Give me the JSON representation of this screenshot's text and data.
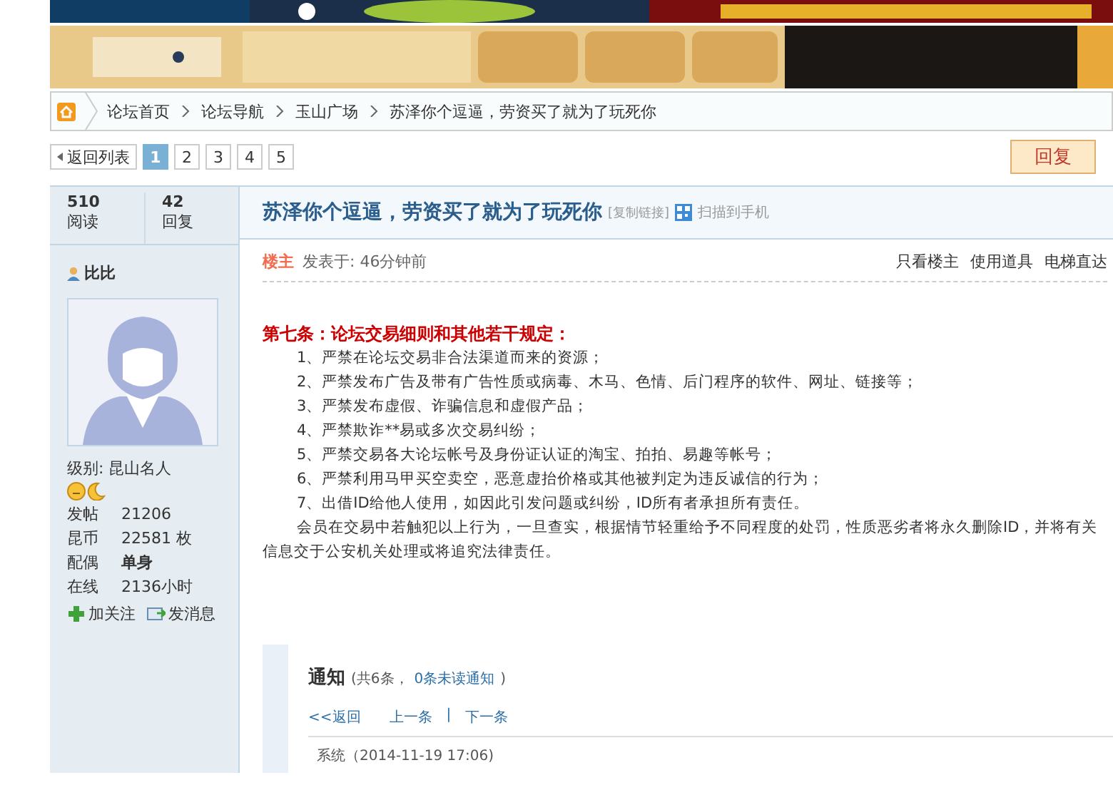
{
  "banners": [
    {
      "kind": "picture"
    },
    {
      "kind": "picture"
    }
  ],
  "breadcrumb": [
    "论坛首页",
    "论坛导航",
    "玉山广场",
    "苏泽你个逗逼，劳资买了就为了玩死你"
  ],
  "pagination": {
    "back": "返回列表",
    "pages": [
      {
        "label": "1",
        "selected": true
      },
      {
        "label": "2",
        "selected": false
      },
      {
        "label": "3",
        "selected": false
      },
      {
        "label": "4",
        "selected": false
      },
      {
        "label": "5",
        "selected": false
      }
    ],
    "reply": "回复"
  },
  "stats": [
    {
      "value": "510",
      "label": "阅读"
    },
    {
      "value": "42",
      "label": "回复"
    }
  ],
  "thread": {
    "title": "苏泽你个逗逼，劳资买了就为了玩死你",
    "copy_link": "[复制链接]",
    "qr": "扫描到手机"
  },
  "author": {
    "name": "比比",
    "level": "级别: 昆山名人",
    "fields": [
      {
        "label": "发帖",
        "value": "21206",
        "bold": false
      },
      {
        "label": "昆币",
        "value": "22581 枚",
        "bold": false
      },
      {
        "label": "配偶",
        "value": "单身",
        "bold": true
      },
      {
        "label": "在线",
        "value": "2136小时",
        "bold": false
      }
    ],
    "actions": [
      "加关注",
      "发消息"
    ]
  },
  "post": {
    "badge": "楼主",
    "time": "发表于: 46分钟前",
    "tools": [
      "只看楼主",
      "使用道具",
      "电梯直达"
    ],
    "heading": "第七条：论坛交易细则和其他若干规定：",
    "items": [
      "1、严禁在论坛交易非合法渠道而来的资源；",
      "2、严禁发布广告及带有广告性质或病毒、木马、色情、后门程序的软件、网址、链接等；",
      "3、严禁发布虚假、诈骗信息和虚假产品；",
      "4、严禁欺诈**易或多次交易纠纷；",
      "5、严禁交易各大论坛帐号及身份证认证的淘宝、拍拍、易趣等帐号；",
      "6、严禁利用马甲买空卖空，恶意虚抬价格或其他被判定为违反诚信的行为；",
      "7、出借ID给他人使用，如因此引发问题或纠纷，ID所有者承担所有责任。"
    ],
    "paragraph": "会员在交易中若触犯以上行为，一旦查实，根据情节轻重给予不同程度的处罚，性质恶劣者将永久删除ID，并将有关信息交于公安机关处理或将追究法律责任。"
  },
  "notice": {
    "title": "通知",
    "count": "(共6条，",
    "unread": "0条未读通知",
    "close": ")",
    "back": "<<返回",
    "prev": "上一条",
    "sep": "|",
    "next": "下一条",
    "meta": "系统（2014-11-19 17:06)"
  }
}
